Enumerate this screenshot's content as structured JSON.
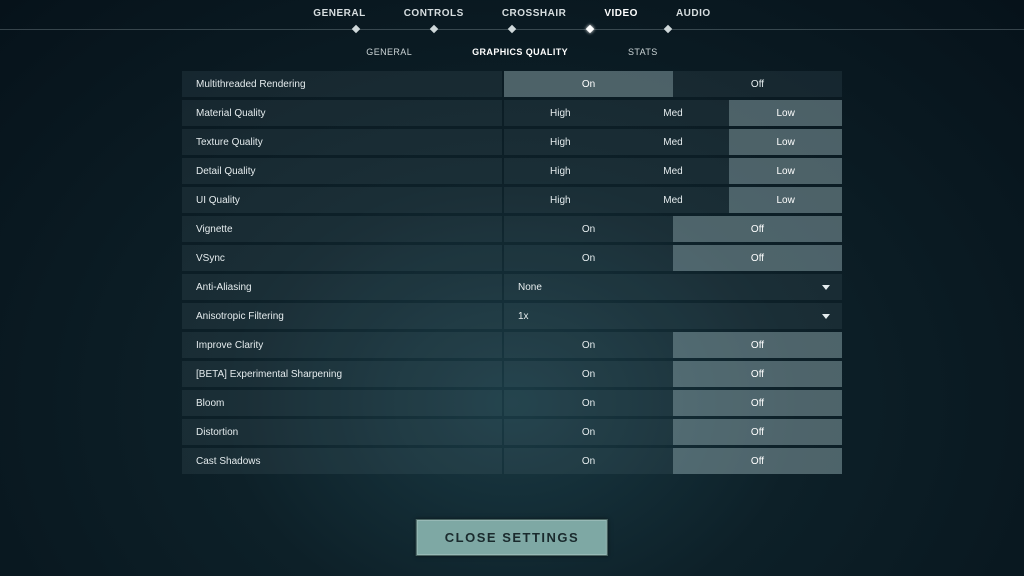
{
  "tabs": {
    "primary": [
      "GENERAL",
      "CONTROLS",
      "CROSSHAIR",
      "VIDEO",
      "AUDIO"
    ],
    "primary_active": 3,
    "secondary": [
      "GENERAL",
      "GRAPHICS QUALITY",
      "STATS"
    ],
    "secondary_active": 1
  },
  "rows": [
    {
      "label": "Multithreaded Rendering",
      "type": "opts",
      "options": [
        "On",
        "Off"
      ],
      "selected": 0
    },
    {
      "label": "Material Quality",
      "type": "opts",
      "options": [
        "High",
        "Med",
        "Low"
      ],
      "selected": 2
    },
    {
      "label": "Texture Quality",
      "type": "opts",
      "options": [
        "High",
        "Med",
        "Low"
      ],
      "selected": 2
    },
    {
      "label": "Detail Quality",
      "type": "opts",
      "options": [
        "High",
        "Med",
        "Low"
      ],
      "selected": 2
    },
    {
      "label": "UI Quality",
      "type": "opts",
      "options": [
        "High",
        "Med",
        "Low"
      ],
      "selected": 2
    },
    {
      "label": "Vignette",
      "type": "opts",
      "options": [
        "On",
        "Off"
      ],
      "selected": 1
    },
    {
      "label": "VSync",
      "type": "opts",
      "options": [
        "On",
        "Off"
      ],
      "selected": 1
    },
    {
      "label": "Anti-Aliasing",
      "type": "dropdown",
      "value": "None"
    },
    {
      "label": "Anisotropic Filtering",
      "type": "dropdown",
      "value": "1x"
    },
    {
      "label": "Improve Clarity",
      "type": "opts",
      "options": [
        "On",
        "Off"
      ],
      "selected": 1
    },
    {
      "label": "[BETA] Experimental Sharpening",
      "type": "opts",
      "options": [
        "On",
        "Off"
      ],
      "selected": 1
    },
    {
      "label": "Bloom",
      "type": "opts",
      "options": [
        "On",
        "Off"
      ],
      "selected": 1
    },
    {
      "label": "Distortion",
      "type": "opts",
      "options": [
        "On",
        "Off"
      ],
      "selected": 1
    },
    {
      "label": "Cast Shadows",
      "type": "opts",
      "options": [
        "On",
        "Off"
      ],
      "selected": 1
    }
  ],
  "close_label": "CLOSE SETTINGS"
}
